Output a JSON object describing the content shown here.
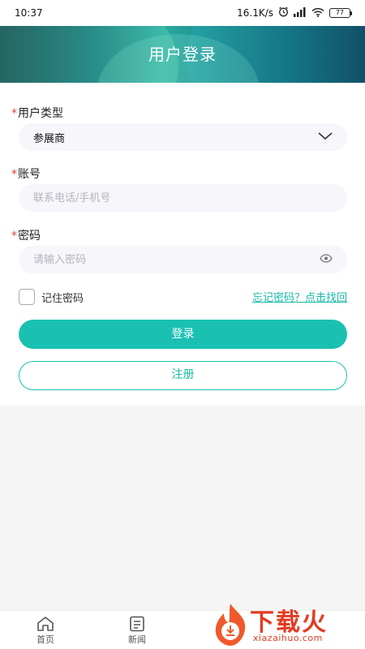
{
  "status_bar": {
    "time": "10:37",
    "speed": "16.1K/s",
    "battery": "77"
  },
  "header": {
    "title": "用户登录"
  },
  "form": {
    "user_type": {
      "label": "用户类型",
      "value": "参展商"
    },
    "account": {
      "label": "账号",
      "placeholder": "联系电话/手机号"
    },
    "password": {
      "label": "密码",
      "placeholder": "请输入密码"
    },
    "remember_label": "记住密码",
    "forgot_label": "忘记密码？点击找回",
    "login_label": "登录",
    "register_label": "注册",
    "required_mark": "*"
  },
  "bottom_nav": {
    "items": [
      {
        "label": "首页",
        "icon": "home-icon"
      },
      {
        "label": "新闻",
        "icon": "news-icon"
      }
    ]
  },
  "watermark": {
    "brand": "下载火",
    "url": "xiazaihuo.com"
  },
  "colors": {
    "accent": "#1ac1b1",
    "required": "#e23b3b",
    "watermark": "#e23c22"
  }
}
